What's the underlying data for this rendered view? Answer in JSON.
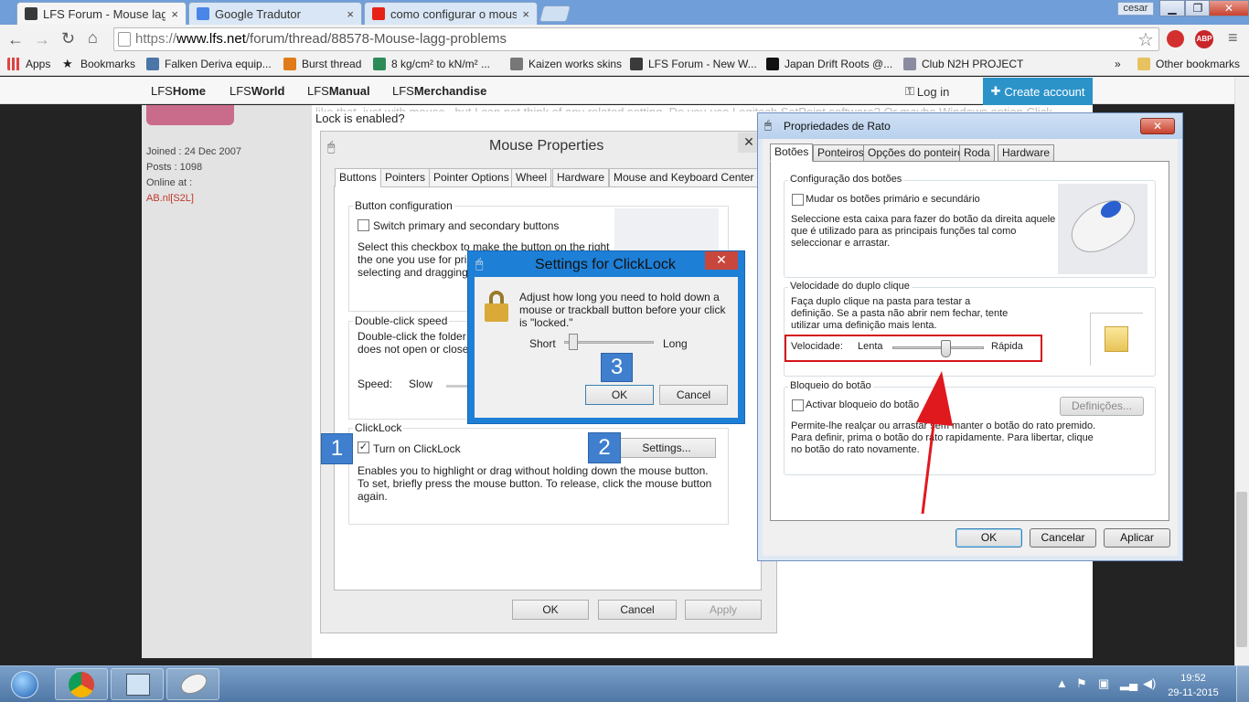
{
  "browser": {
    "tabs": [
      {
        "label": "LFS Forum - Mouse lagg/",
        "close": "×"
      },
      {
        "label": "Google Tradutor",
        "close": "×"
      },
      {
        "label": "como configurar o mouse",
        "close": "×"
      }
    ],
    "user": "cesar",
    "url": {
      "protocol": "https://",
      "host": "www.lfs.net",
      "path": "/forum/thread/88578-Mouse-lagg-problems"
    },
    "bookmarks": [
      {
        "label": "Apps"
      },
      {
        "label": "Bookmarks"
      },
      {
        "label": "Falken Deriva equip..."
      },
      {
        "label": "Burst thread"
      },
      {
        "label": "8 kg/cm² to kN/m² ..."
      },
      {
        "label": "Kaizen works skins"
      },
      {
        "label": "LFS Forum - New W..."
      },
      {
        "label": "Japan Drift Roots @..."
      },
      {
        "label": "Club N2H PROJECT"
      }
    ],
    "bookmarks_overflow": "»",
    "other_bookmarks": "Other bookmarks"
  },
  "site": {
    "nav": [
      {
        "prefix": "LFS",
        "label": "Home"
      },
      {
        "prefix": "LFS",
        "label": "World"
      },
      {
        "prefix": "LFS",
        "label": "Manual"
      },
      {
        "prefix": "LFS",
        "label": "Merchandise"
      }
    ],
    "login": "Log in",
    "create_account": "Create account"
  },
  "post": {
    "joined": "Joined : 24 Dec 2007",
    "posts": "Posts : 1098",
    "online_at_label": "Online at :",
    "online_at_value": "AB.nl[S2L]",
    "text_partial": "like that, just with mouse...but I can not think of any related setting. Do you use Logitech SetPoint software? Or maybe Windows option Click",
    "text_line2": "Lock is enabled?"
  },
  "mouse_properties": {
    "title": "Mouse Properties",
    "tabs": [
      "Buttons",
      "Pointers",
      "Pointer Options",
      "Wheel",
      "Hardware",
      "Mouse and Keyboard Center"
    ],
    "button_config_label": "Button configuration",
    "switch_label": "Switch primary and secondary buttons",
    "switch_desc": [
      "Select this checkbox to make the button on the right",
      "the one you use for prim",
      "selecting and dragging"
    ],
    "double_click_label": "Double-click speed",
    "double_click_desc": [
      "Double-click the folder t",
      "does not open or close"
    ],
    "speed_label": "Speed:",
    "speed_slow": "Slow",
    "clicklock_label": "ClickLock",
    "clicklock_checkbox": "Turn on ClickLock",
    "clicklock_checked": "✓",
    "settings_button": "Settings...",
    "clicklock_desc": [
      "Enables you to highlight or drag without holding down the mouse button.",
      "To set, briefly press the mouse button. To release, click the mouse button",
      "again."
    ],
    "ok": "OK",
    "cancel": "Cancel",
    "apply": "Apply"
  },
  "callouts": {
    "one": "1",
    "two": "2",
    "three": "3"
  },
  "clicklock_settings": {
    "title": "Settings for ClickLock",
    "desc": [
      "Adjust how long you need to hold down a",
      "mouse or trackball button before your click",
      "is \"locked.\""
    ],
    "short": "Short",
    "long": "Long",
    "slider_value": 0.1,
    "ok": "OK",
    "cancel": "Cancel"
  },
  "propriedades": {
    "title": "Propriedades de Rato",
    "tabs": [
      "Botões",
      "Ponteiros",
      "Opções do ponteiro",
      "Roda",
      "Hardware"
    ],
    "config_label": "Configuração dos botões",
    "switch_label": "Mudar os botões primário e secundário",
    "switch_desc": [
      "Seleccione esta caixa para fazer do botão da direita aquele",
      "que é utilizado para as principais funções tal como",
      "seleccionar e arrastar."
    ],
    "double_label": "Velocidade do duplo clique",
    "double_desc": [
      "Faça duplo clique na pasta para testar a",
      "definição. Se a pasta não abrir nem fechar, tente",
      "utilizar uma definição mais lenta."
    ],
    "speed_label": "Velocidade:",
    "speed_slow": "Lenta",
    "speed_fast": "Rápida",
    "speed_value": 0.58,
    "lock_label": "Bloqueio do botão",
    "lock_checkbox": "Activar bloqueio do botão",
    "definicoes": "Definições...",
    "lock_desc": [
      "Permite-lhe realçar ou arrastar sem manter o botão do rato premido.",
      "Para definir, prima o botão do rato rapidamente. Para libertar, clique",
      "no botão do rato novamente."
    ],
    "ok": "OK",
    "cancel": "Cancelar",
    "apply": "Aplicar"
  },
  "taskbar": {
    "time": "19:52",
    "date": "29-11-2015"
  },
  "colors": {
    "annotation_red": "#d4141a",
    "callout_blue": "#3f7fce",
    "accent_blue": "#2c93c9"
  }
}
